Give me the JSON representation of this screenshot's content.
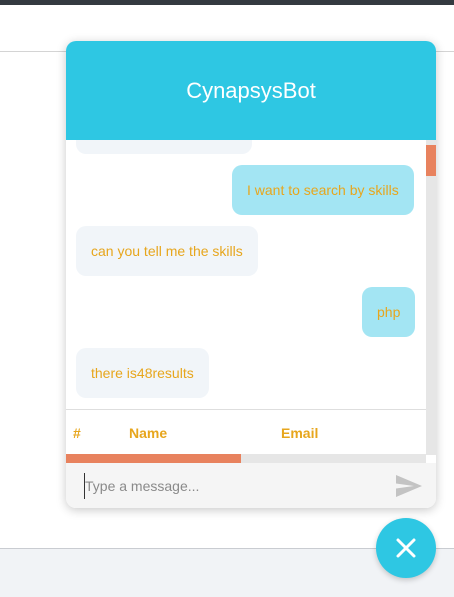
{
  "chat": {
    "title": "CynapsysBot",
    "messages": [
      {
        "sender": "user",
        "text": "I want to search by skills"
      },
      {
        "sender": "bot",
        "text": "can you tell me the skills"
      },
      {
        "sender": "user",
        "text": "php"
      },
      {
        "sender": "bot",
        "text": "there is48results"
      }
    ],
    "results_table": {
      "columns": [
        "#",
        "Name",
        "Email"
      ]
    },
    "composer": {
      "placeholder": "Type a message..."
    }
  },
  "icons": {
    "send": "send-icon",
    "close": "close-icon"
  },
  "colors": {
    "accent": "#2ec7e3",
    "message_text": "#e7a61d",
    "user_bubble": "#a3e5f3",
    "bot_bubble": "#f1f5f9",
    "scroll_thumb": "#e8825e"
  }
}
